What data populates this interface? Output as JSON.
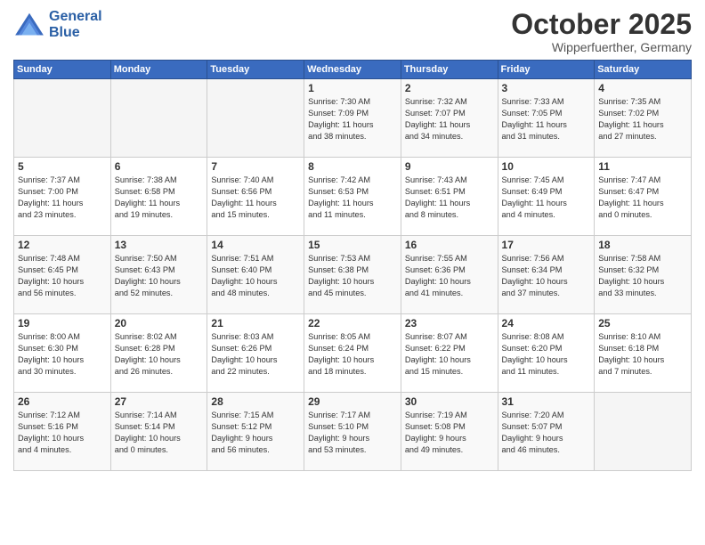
{
  "header": {
    "logo_line1": "General",
    "logo_line2": "Blue",
    "month": "October 2025",
    "location": "Wipperfuerther, Germany"
  },
  "weekdays": [
    "Sunday",
    "Monday",
    "Tuesday",
    "Wednesday",
    "Thursday",
    "Friday",
    "Saturday"
  ],
  "weeks": [
    [
      {
        "day": "",
        "info": ""
      },
      {
        "day": "",
        "info": ""
      },
      {
        "day": "",
        "info": ""
      },
      {
        "day": "1",
        "info": "Sunrise: 7:30 AM\nSunset: 7:09 PM\nDaylight: 11 hours\nand 38 minutes."
      },
      {
        "day": "2",
        "info": "Sunrise: 7:32 AM\nSunset: 7:07 PM\nDaylight: 11 hours\nand 34 minutes."
      },
      {
        "day": "3",
        "info": "Sunrise: 7:33 AM\nSunset: 7:05 PM\nDaylight: 11 hours\nand 31 minutes."
      },
      {
        "day": "4",
        "info": "Sunrise: 7:35 AM\nSunset: 7:02 PM\nDaylight: 11 hours\nand 27 minutes."
      }
    ],
    [
      {
        "day": "5",
        "info": "Sunrise: 7:37 AM\nSunset: 7:00 PM\nDaylight: 11 hours\nand 23 minutes."
      },
      {
        "day": "6",
        "info": "Sunrise: 7:38 AM\nSunset: 6:58 PM\nDaylight: 11 hours\nand 19 minutes."
      },
      {
        "day": "7",
        "info": "Sunrise: 7:40 AM\nSunset: 6:56 PM\nDaylight: 11 hours\nand 15 minutes."
      },
      {
        "day": "8",
        "info": "Sunrise: 7:42 AM\nSunset: 6:53 PM\nDaylight: 11 hours\nand 11 minutes."
      },
      {
        "day": "9",
        "info": "Sunrise: 7:43 AM\nSunset: 6:51 PM\nDaylight: 11 hours\nand 8 minutes."
      },
      {
        "day": "10",
        "info": "Sunrise: 7:45 AM\nSunset: 6:49 PM\nDaylight: 11 hours\nand 4 minutes."
      },
      {
        "day": "11",
        "info": "Sunrise: 7:47 AM\nSunset: 6:47 PM\nDaylight: 11 hours\nand 0 minutes."
      }
    ],
    [
      {
        "day": "12",
        "info": "Sunrise: 7:48 AM\nSunset: 6:45 PM\nDaylight: 10 hours\nand 56 minutes."
      },
      {
        "day": "13",
        "info": "Sunrise: 7:50 AM\nSunset: 6:43 PM\nDaylight: 10 hours\nand 52 minutes."
      },
      {
        "day": "14",
        "info": "Sunrise: 7:51 AM\nSunset: 6:40 PM\nDaylight: 10 hours\nand 48 minutes."
      },
      {
        "day": "15",
        "info": "Sunrise: 7:53 AM\nSunset: 6:38 PM\nDaylight: 10 hours\nand 45 minutes."
      },
      {
        "day": "16",
        "info": "Sunrise: 7:55 AM\nSunset: 6:36 PM\nDaylight: 10 hours\nand 41 minutes."
      },
      {
        "day": "17",
        "info": "Sunrise: 7:56 AM\nSunset: 6:34 PM\nDaylight: 10 hours\nand 37 minutes."
      },
      {
        "day": "18",
        "info": "Sunrise: 7:58 AM\nSunset: 6:32 PM\nDaylight: 10 hours\nand 33 minutes."
      }
    ],
    [
      {
        "day": "19",
        "info": "Sunrise: 8:00 AM\nSunset: 6:30 PM\nDaylight: 10 hours\nand 30 minutes."
      },
      {
        "day": "20",
        "info": "Sunrise: 8:02 AM\nSunset: 6:28 PM\nDaylight: 10 hours\nand 26 minutes."
      },
      {
        "day": "21",
        "info": "Sunrise: 8:03 AM\nSunset: 6:26 PM\nDaylight: 10 hours\nand 22 minutes."
      },
      {
        "day": "22",
        "info": "Sunrise: 8:05 AM\nSunset: 6:24 PM\nDaylight: 10 hours\nand 18 minutes."
      },
      {
        "day": "23",
        "info": "Sunrise: 8:07 AM\nSunset: 6:22 PM\nDaylight: 10 hours\nand 15 minutes."
      },
      {
        "day": "24",
        "info": "Sunrise: 8:08 AM\nSunset: 6:20 PM\nDaylight: 10 hours\nand 11 minutes."
      },
      {
        "day": "25",
        "info": "Sunrise: 8:10 AM\nSunset: 6:18 PM\nDaylight: 10 hours\nand 7 minutes."
      }
    ],
    [
      {
        "day": "26",
        "info": "Sunrise: 7:12 AM\nSunset: 5:16 PM\nDaylight: 10 hours\nand 4 minutes."
      },
      {
        "day": "27",
        "info": "Sunrise: 7:14 AM\nSunset: 5:14 PM\nDaylight: 10 hours\nand 0 minutes."
      },
      {
        "day": "28",
        "info": "Sunrise: 7:15 AM\nSunset: 5:12 PM\nDaylight: 9 hours\nand 56 minutes."
      },
      {
        "day": "29",
        "info": "Sunrise: 7:17 AM\nSunset: 5:10 PM\nDaylight: 9 hours\nand 53 minutes."
      },
      {
        "day": "30",
        "info": "Sunrise: 7:19 AM\nSunset: 5:08 PM\nDaylight: 9 hours\nand 49 minutes."
      },
      {
        "day": "31",
        "info": "Sunrise: 7:20 AM\nSunset: 5:07 PM\nDaylight: 9 hours\nand 46 minutes."
      },
      {
        "day": "",
        "info": ""
      }
    ]
  ]
}
